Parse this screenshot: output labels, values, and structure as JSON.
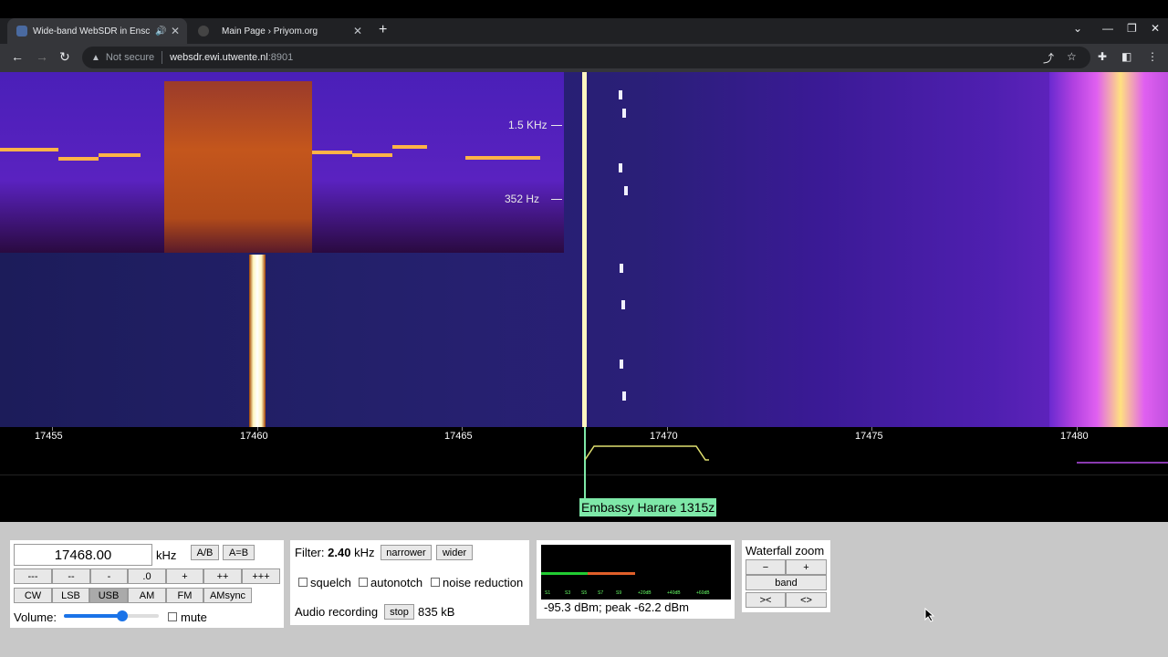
{
  "browser": {
    "tabs": [
      {
        "title": "Wide-band WebSDR in Ensch",
        "active": true
      },
      {
        "title": "Main Page › Priyom.org",
        "active": false
      }
    ],
    "security": "Not secure",
    "url_host": "websdr.ewi.utwente.nl",
    "url_port": ":8901"
  },
  "waterfall": {
    "spectrogram_labels": [
      "1.5  KHz",
      "352  Hz"
    ],
    "scale": [
      {
        "label": "17455"
      },
      {
        "label": "17460"
      },
      {
        "label": "17465"
      },
      {
        "label": "17470"
      },
      {
        "label": "17475"
      },
      {
        "label": "17480"
      }
    ],
    "station_label": "Embassy Harare 1315z"
  },
  "tuning": {
    "frequency": "17468.00",
    "unit": "kHz",
    "ab_label": "A/B",
    "aeqb_label": "A=B",
    "step_buttons": [
      "---",
      "--",
      "-",
      ".0",
      "+",
      "++",
      "+++"
    ],
    "modes": [
      "CW",
      "LSB",
      "USB",
      "AM",
      "FM",
      "AMsync"
    ],
    "active_mode": "USB",
    "volume_label": "Volume:",
    "volume_level": 0.62,
    "mute_label": "mute"
  },
  "filter": {
    "prefix": "Filter:",
    "bandwidth": "2.40",
    "unit": "kHz",
    "narrower": "narrower",
    "wider": "wider",
    "squelch": "squelch",
    "autonotch": "autonotch",
    "noise_reduction": "noise reduction",
    "recording_label": "Audio recording",
    "stop": "stop",
    "size": "835 kB"
  },
  "smeter": {
    "scale": [
      "S1",
      "S3",
      "S5",
      "S7",
      "S9",
      "+20dB",
      "+40dB",
      "+60dB"
    ],
    "reading": "-95.3 dBm; peak  -62.2 dBm",
    "green_color": "#22cc33",
    "orange_color": "#e0602a"
  },
  "zoom": {
    "title": "Waterfall zoom",
    "minus": "−",
    "plus": "+",
    "band": "band",
    "narrow": "><",
    "wide": "<>"
  }
}
